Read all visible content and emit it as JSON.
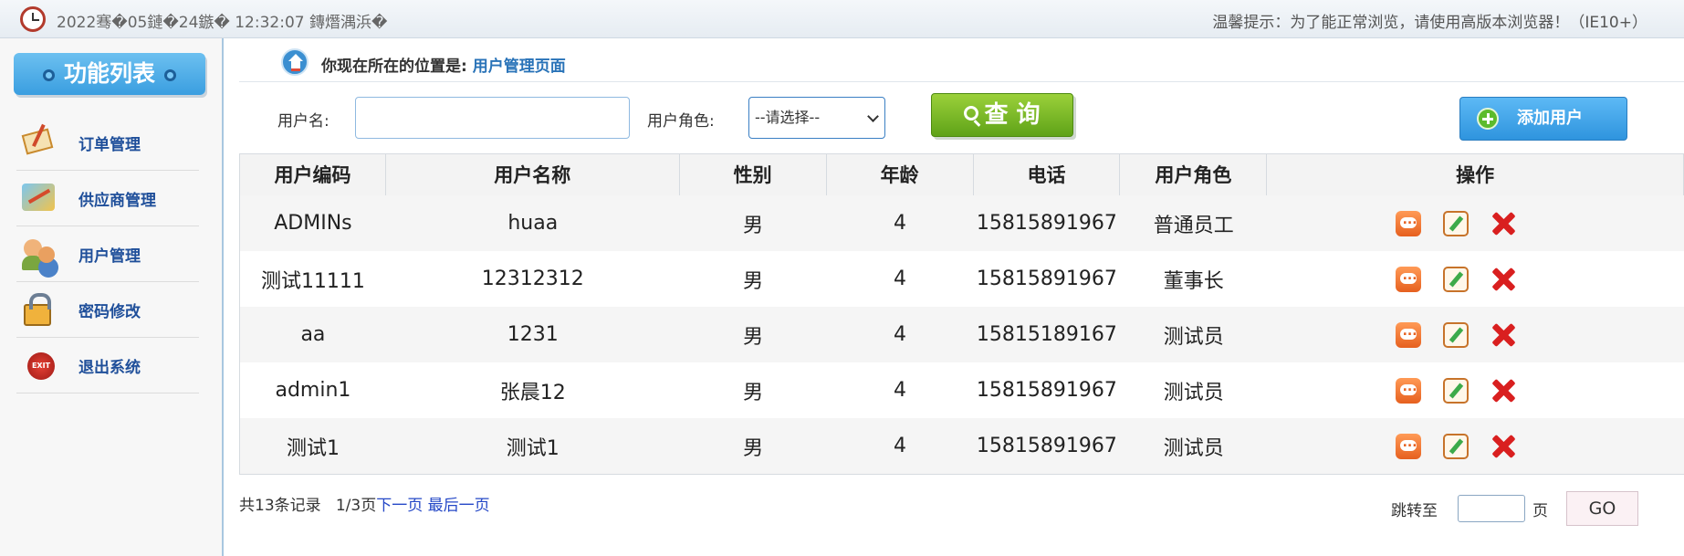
{
  "topbar": {
    "datetime": "2022骞�05鏈�24鏃� 12:32:07 鏄熸湡浜�",
    "tip": "温馨提示：为了能正常浏览，请使用高版本浏览器！（IE10+）"
  },
  "sidebar": {
    "title": "功能列表",
    "items": [
      {
        "label": "订单管理",
        "icon": "order-icon"
      },
      {
        "label": "供应商管理",
        "icon": "supplier-icon"
      },
      {
        "label": "用户管理",
        "icon": "users-icon"
      },
      {
        "label": "密码修改",
        "icon": "lock-icon"
      },
      {
        "label": "退出系统",
        "icon": "exit-icon"
      }
    ],
    "exit_icon_text": "EXIT"
  },
  "breadcrumb": {
    "prefix": "你现在所在的位置是: ",
    "current": "用户管理页面"
  },
  "search": {
    "username_label": "用户名:",
    "username_value": "",
    "role_label": "用户角色:",
    "role_selected": "--请选择--",
    "query_button": "查 询",
    "add_button": "添加用户"
  },
  "table": {
    "headers": [
      "用户编码",
      "用户名称",
      "性别",
      "年龄",
      "电话",
      "用户角色",
      "操作"
    ],
    "rows": [
      [
        "ADMINs",
        "huaa",
        "男",
        "4",
        "15815891967",
        "普通员工"
      ],
      [
        "测试11111",
        "12312312",
        "男",
        "4",
        "15815891967",
        "董事长"
      ],
      [
        "aa",
        "1231",
        "男",
        "4",
        "15815189167",
        "测试员"
      ],
      [
        "admin1",
        "张晨12",
        "男",
        "4",
        "15815891967",
        "测试员"
      ],
      [
        "测试1",
        "测试1",
        "男",
        "4",
        "15815891967",
        "测试员"
      ]
    ]
  },
  "pagination": {
    "total": "共13条记录",
    "pages": "1/3页",
    "next": "下一页",
    "last": "最后一页",
    "jump_label": "跳转至",
    "page_unit": "页",
    "go": "GO"
  },
  "colors": {
    "accent": "#3a9ee0",
    "query_green": "#5fa318",
    "link": "#2973b8"
  }
}
